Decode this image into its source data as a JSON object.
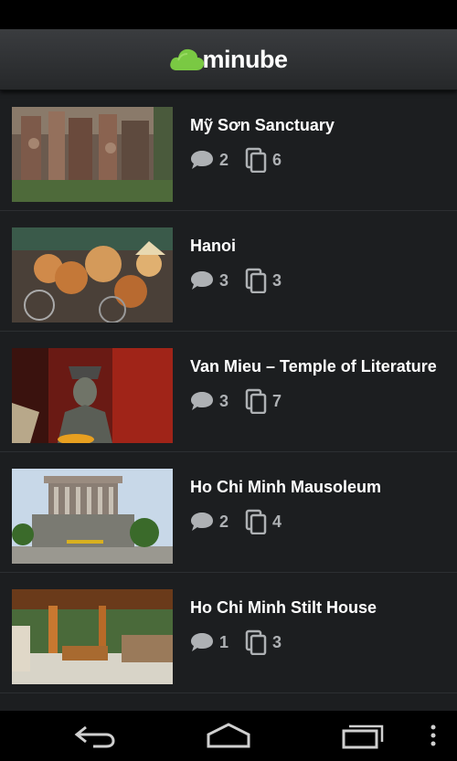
{
  "app": {
    "logo_text": "minube"
  },
  "places": [
    {
      "name": "Mỹ Sơn Sanctuary",
      "comments": "2",
      "photos": "6"
    },
    {
      "name": "Hanoi",
      "comments": "3",
      "photos": "3"
    },
    {
      "name": "Van Mieu – Temple of Literature",
      "comments": "3",
      "photos": "7"
    },
    {
      "name": "Ho Chi Minh Mausoleum",
      "comments": "2",
      "photos": "4"
    },
    {
      "name": "Ho Chi Minh Stilt House",
      "comments": "1",
      "photos": "3"
    }
  ],
  "icons": {
    "comment": "comment-bubble-icon",
    "photos": "photo-stack-icon",
    "back": "back-icon",
    "home": "home-icon",
    "recents": "recent-apps-icon",
    "menu": "overflow-menu-icon"
  },
  "colors": {
    "brand": "#7ac943",
    "background": "#1c1e20",
    "stat_text": "#aeb1b4"
  }
}
